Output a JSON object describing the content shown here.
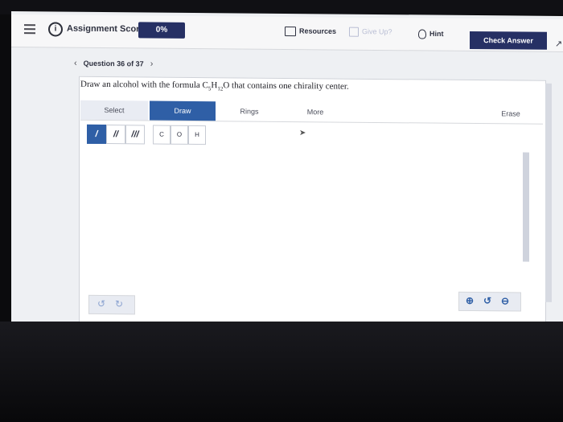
{
  "header": {
    "score_label": "Assignment Score:",
    "score_value": "0%",
    "resources_label": "Resources",
    "giveup_label": "Give Up?",
    "hint_label": "Hint",
    "check_label": "Check Answer"
  },
  "question_nav": {
    "label": "Question 36 of 37"
  },
  "question": {
    "text_before": "Draw an alcohol with the formula C",
    "sub1": "5",
    "mid": "H",
    "sub2": "12",
    "text_after": "O that contains one chirality center."
  },
  "tabs": {
    "select": "Select",
    "draw": "Draw",
    "rings": "Rings",
    "more": "More",
    "erase": "Erase"
  },
  "tools": {
    "bond_single": "/",
    "bond_double": "//",
    "bond_triple": "///",
    "atom_c": "C",
    "atom_o": "O",
    "atom_h": "H"
  },
  "colors": {
    "accent": "#2f5fa6",
    "header_dark": "#263064"
  }
}
